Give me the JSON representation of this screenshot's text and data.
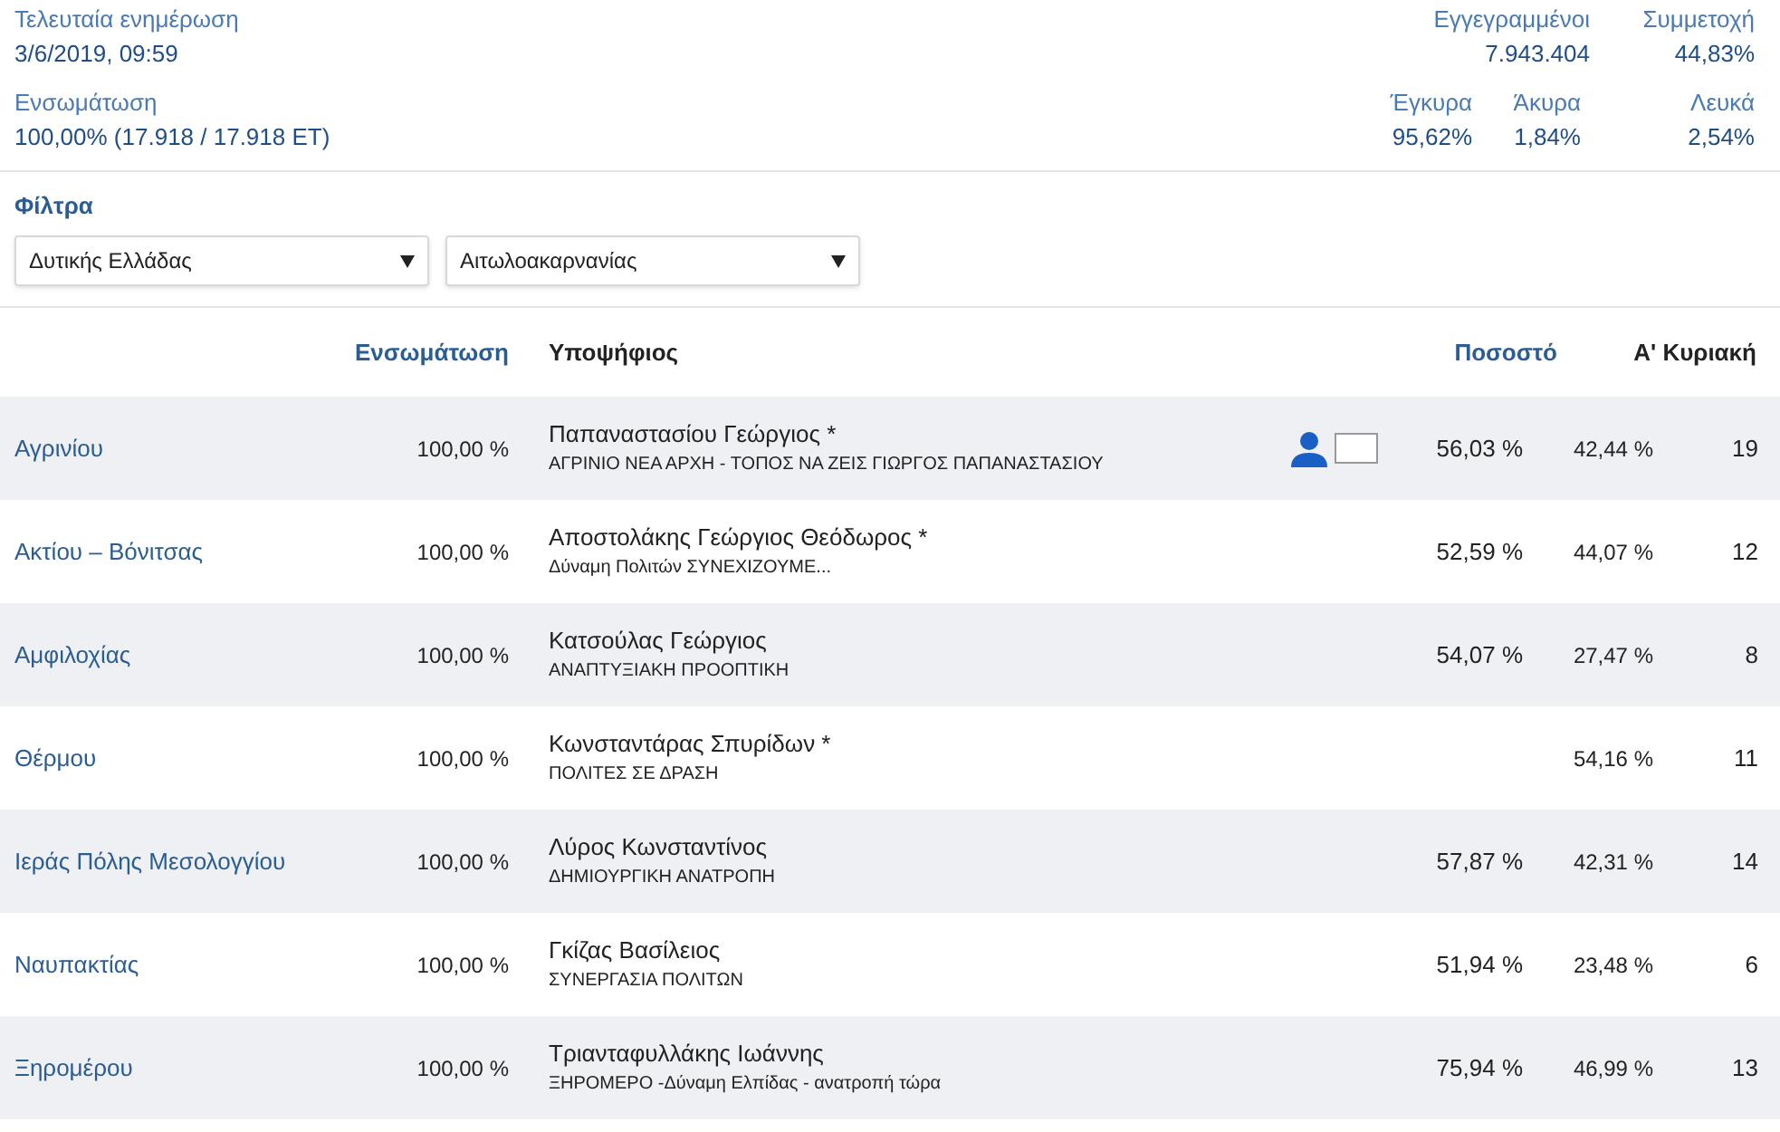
{
  "summary": {
    "last_update": {
      "label": "Τελευταία ενημέρωση",
      "value": "3/6/2019, 09:59"
    },
    "integration": {
      "label": "Ενσωμάτωση",
      "value": "100,00% (17.918 / 17.918 ΕΤ)"
    },
    "top_stats": [
      {
        "label": "Εγγεγραμμένοι",
        "value": "7.943.404"
      },
      {
        "label": "Συμμετοχή",
        "value": "44,83%"
      }
    ],
    "bottom_stats": [
      {
        "label": "Έγκυρα",
        "value": "95,62%"
      },
      {
        "label": "Άκυρα",
        "value": "1,84%"
      },
      {
        "label": "Λευκά",
        "value": "2,54%"
      }
    ]
  },
  "filters": {
    "title": "Φίλτρα",
    "selects": [
      {
        "value": "Δυτικής Ελλάδας"
      },
      {
        "value": "Αιτωλοακαρνανίας"
      }
    ]
  },
  "table": {
    "columns": [
      "Ενσωμάτωση",
      "Υποψήφιος",
      "Ποσοστό",
      "Α' Κυριακή"
    ],
    "rows": [
      {
        "municipality": "Αγρινίου",
        "integration": "100,00 %",
        "candidate": "Παπαναστασίου Γεώργιος *",
        "party": "ΑΓΡΙΝΙΟ ΝΕΑ ΑΡΧΗ - ΤΟΠΟΣ ΝΑ ΖΕΙΣ ΓΙΩΡΓΟΣ ΠΑΠΑΝΑΣΤΑΣΙΟΥ",
        "profile": true,
        "percent": "56,03 %",
        "first_sunday": "42,44 %",
        "seats": "19"
      },
      {
        "municipality": "Ακτίου – Βόνιτσας",
        "integration": "100,00 %",
        "candidate": "Αποστολάκης Γεώργιος Θεόδωρος *",
        "party": "Δύναμη Πολιτών ΣΥΝΕΧΙΖΟΥΜΕ...",
        "profile": false,
        "percent": "52,59 %",
        "first_sunday": "44,07 %",
        "seats": "12"
      },
      {
        "municipality": "Αμφιλοχίας",
        "integration": "100,00 %",
        "candidate": "Κατσούλας Γεώργιος",
        "party": "ΑΝΑΠΤΥΞΙΑΚΗ ΠΡΟΟΠΤΙΚΗ",
        "profile": false,
        "percent": "54,07 %",
        "first_sunday": "27,47 %",
        "seats": "8"
      },
      {
        "municipality": "Θέρμου",
        "integration": "100,00 %",
        "candidate": "Κωνσταντάρας Σπυρίδων *",
        "party": "ΠΟΛΙΤΕΣ ΣΕ ΔΡΑΣΗ",
        "profile": false,
        "first_sunday": "54,16 %",
        "seats": "11"
      },
      {
        "municipality": "Ιεράς Πόλης Μεσολογγίου",
        "integration": "100,00 %",
        "candidate": "Λύρος Κωνσταντίνος",
        "party": "ΔΗΜΙΟΥΡΓΙΚΗ ΑΝΑΤΡΟΠΗ",
        "profile": false,
        "percent": "57,87 %",
        "first_sunday": "42,31 %",
        "seats": "14"
      },
      {
        "municipality": "Ναυπακτίας",
        "integration": "100,00 %",
        "candidate": "Γκίζας Βασίλειος",
        "party": "ΣΥΝΕΡΓΑΣΙΑ ΠΟΛΙΤΩΝ",
        "profile": false,
        "percent": "51,94 %",
        "first_sunday": "23,48 %",
        "seats": "6"
      },
      {
        "municipality": "Ξηρομέρου",
        "integration": "100,00 %",
        "candidate": "Τριανταφυλλάκης Ιωάννης",
        "party": "ΞΗΡΟΜΕΡΟ -Δύναμη Ελπίδας - ανατροπή τώρα",
        "profile": false,
        "percent": "75,94 %",
        "first_sunday": "46,99 %",
        "seats": "13"
      }
    ]
  }
}
